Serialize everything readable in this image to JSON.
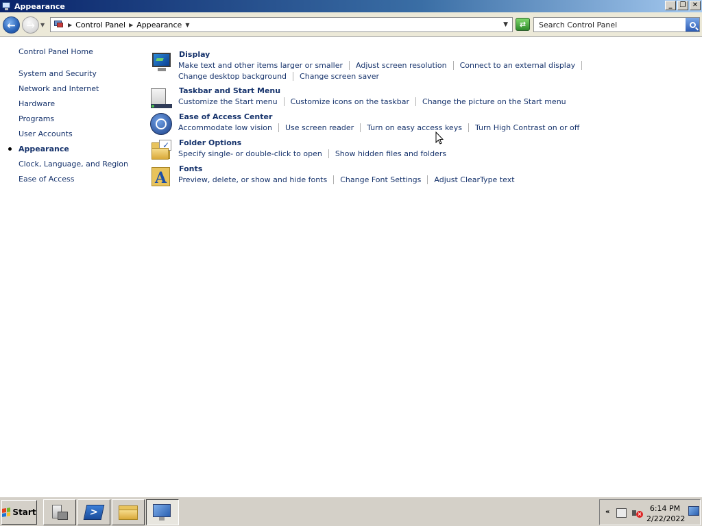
{
  "window": {
    "title": "Appearance",
    "controls": {
      "minimize": "_",
      "maximize": "❐",
      "close": "✕"
    }
  },
  "address": {
    "breadcrumbs": [
      "Control Panel",
      "Appearance"
    ],
    "search_placeholder": "Search Control Panel"
  },
  "sidebar": {
    "home": "Control Panel Home",
    "items": [
      {
        "label": "System and Security"
      },
      {
        "label": "Network and Internet"
      },
      {
        "label": "Hardware"
      },
      {
        "label": "Programs"
      },
      {
        "label": "User Accounts"
      },
      {
        "label": "Appearance",
        "current": true
      },
      {
        "label": "Clock, Language, and Region"
      },
      {
        "label": "Ease of Access"
      }
    ]
  },
  "categories": [
    {
      "title": "Display",
      "icon": "display-icon",
      "rows": [
        [
          "Make text and other items larger or smaller",
          "Adjust screen resolution",
          "Connect to an external display",
          ""
        ],
        [
          "Change desktop background",
          "Change screen saver"
        ]
      ]
    },
    {
      "title": "Taskbar and Start Menu",
      "icon": "taskbar-icon",
      "rows": [
        [
          "Customize the Start menu",
          "Customize icons on the taskbar",
          "Change the picture on the Start menu"
        ]
      ]
    },
    {
      "title": "Ease of Access Center",
      "icon": "ease-of-access-icon",
      "rows": [
        [
          "Accommodate low vision",
          "Use screen reader",
          "Turn on easy access keys",
          "Turn High Contrast on or off"
        ]
      ]
    },
    {
      "title": "Folder Options",
      "icon": "folder-options-icon",
      "rows": [
        [
          "Specify single- or double-click to open",
          "Show hidden files and folders"
        ]
      ]
    },
    {
      "title": "Fonts",
      "icon": "fonts-icon",
      "rows": [
        [
          "Preview, delete, or show and hide fonts",
          "Change Font Settings",
          "Adjust ClearType text"
        ]
      ]
    }
  ],
  "taskbar": {
    "start_label": "Start",
    "ps_glyph": ">",
    "tray_show": "«",
    "time": "6:14 PM",
    "date": "2/22/2022"
  },
  "colors": {
    "link": "#15326b",
    "title_bar_start": "#0a246a",
    "title_bar_end": "#a6caf0",
    "chrome": "#d4d0c8"
  }
}
